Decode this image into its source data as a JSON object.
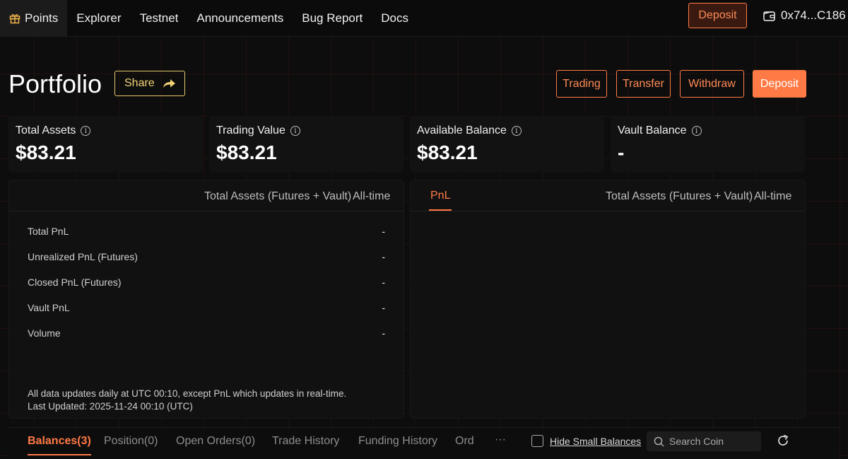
{
  "nav": {
    "items": [
      {
        "label": "Points"
      },
      {
        "label": "Explorer"
      },
      {
        "label": "Testnet"
      },
      {
        "label": "Announcements"
      },
      {
        "label": "Bug Report"
      },
      {
        "label": "Docs"
      }
    ],
    "deposit_label": "Deposit",
    "wallet_address": "0x74...C186"
  },
  "header": {
    "title": "Portfolio",
    "share_label": "Share",
    "actions": [
      "Trading",
      "Transfer",
      "Withdraw",
      "Deposit"
    ]
  },
  "cards": [
    {
      "label": "Total Assets",
      "value": "$83.21"
    },
    {
      "label": "Trading Value",
      "value": "$83.21"
    },
    {
      "label": "Available Balance",
      "value": "$83.21"
    },
    {
      "label": "Vault Balance",
      "value": "-"
    }
  ],
  "left_panel": {
    "scope": "Total Assets (Futures + Vault)",
    "range": "All-time",
    "stats": [
      {
        "label": "Total PnL",
        "value": "-"
      },
      {
        "label": "Unrealized PnL (Futures)",
        "value": "-"
      },
      {
        "label": "Closed PnL (Futures)",
        "value": "-"
      },
      {
        "label": "Vault PnL",
        "value": "-"
      },
      {
        "label": "Volume",
        "value": "-"
      }
    ],
    "note_line1": "All data updates daily at UTC 00:10, except PnL which updates in real-time.",
    "note_line2": "Last Updated: 2025-11-24 00:10 (UTC)"
  },
  "right_panel": {
    "tab": "PnL",
    "scope": "Total Assets (Futures + Vault)",
    "range": "All-time"
  },
  "bottom_tabs": {
    "tabs": [
      "Balances(3)",
      "Position(0)",
      "Open Orders(0)",
      "Trade History",
      "Funding History",
      "Ord"
    ],
    "more": "···",
    "hide_small_label": "Hide Small Balances",
    "search_placeholder": "Search Coin"
  },
  "colors": {
    "accent": "#ff7a45",
    "share": "#e3c76a",
    "background": "#0d0d0d"
  }
}
